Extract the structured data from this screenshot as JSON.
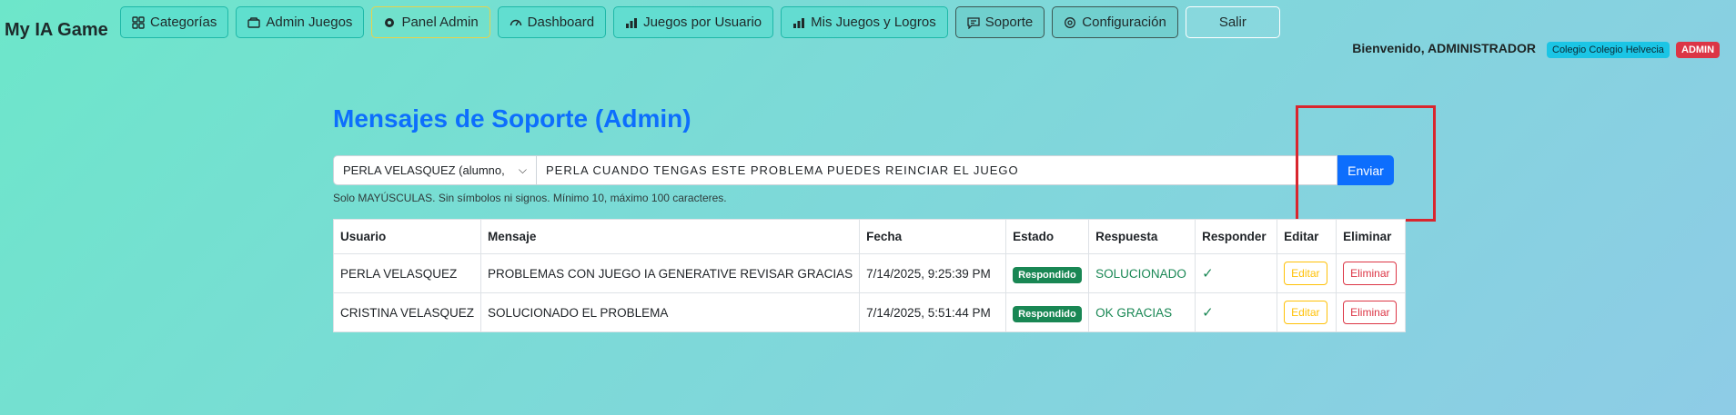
{
  "app": {
    "brand": "My IA Game"
  },
  "nav": [
    {
      "label": "Categorías",
      "icon": "grid-icon"
    },
    {
      "label": "Admin Juegos",
      "icon": "box-icon"
    },
    {
      "label": "Panel Admin",
      "icon": "gear-icon"
    },
    {
      "label": "Dashboard",
      "icon": "speedometer-icon"
    },
    {
      "label": "Juegos por Usuario",
      "icon": "bar-chart-icon"
    },
    {
      "label": "Mis Juegos y Logros",
      "icon": "bar-chart-icon"
    },
    {
      "label": "Soporte",
      "icon": "chat-icon"
    },
    {
      "label": "Configuración",
      "icon": "gear-icon"
    },
    {
      "label": "Salir"
    }
  ],
  "header": {
    "welcome": "Bienvenido, ADMINISTRADOR",
    "school_badge": "Colegio Colegio Helvecia",
    "role_badge": "ADMIN"
  },
  "page": {
    "title": "Mensajes de Soporte (Admin)",
    "user_select": "PERLA VELASQUEZ (alumno,",
    "message_value": "PERLA CUANDO TENGAS ESTE PROBLEMA PUEDES REINCIAR EL JUEGO",
    "send_label": "Enviar",
    "helper": "Solo MAYÚSCULAS. Sin símbolos ni signos. Mínimo 10, máximo 100 caracteres."
  },
  "table": {
    "headers": [
      "Usuario",
      "Mensaje",
      "Fecha",
      "Estado",
      "Respuesta",
      "Responder",
      "Editar",
      "Eliminar"
    ],
    "rows": [
      {
        "usuario": "PERLA VELASQUEZ",
        "mensaje": "PROBLEMAS CON JUEGO IA GENERATIVE REVISAR GRACIAS",
        "fecha": "7/14/2025, 9:25:39 PM",
        "estado": "Respondido",
        "respuesta": "SOLUCIONADO",
        "responder": "✓",
        "editar": "Editar",
        "eliminar": "Eliminar"
      },
      {
        "usuario": "CRISTINA VELASQUEZ",
        "mensaje": "SOLUCIONADO EL PROBLEMA",
        "fecha": "7/14/2025, 5:51:44 PM",
        "estado": "Respondido",
        "respuesta": "OK GRACIAS",
        "responder": "✓",
        "editar": "Editar",
        "eliminar": "Eliminar"
      }
    ]
  },
  "colors": {
    "primary": "#0d6efd",
    "success": "#198754",
    "danger": "#dc3545",
    "warning": "#ffc107",
    "info": "#1bc5e5"
  }
}
